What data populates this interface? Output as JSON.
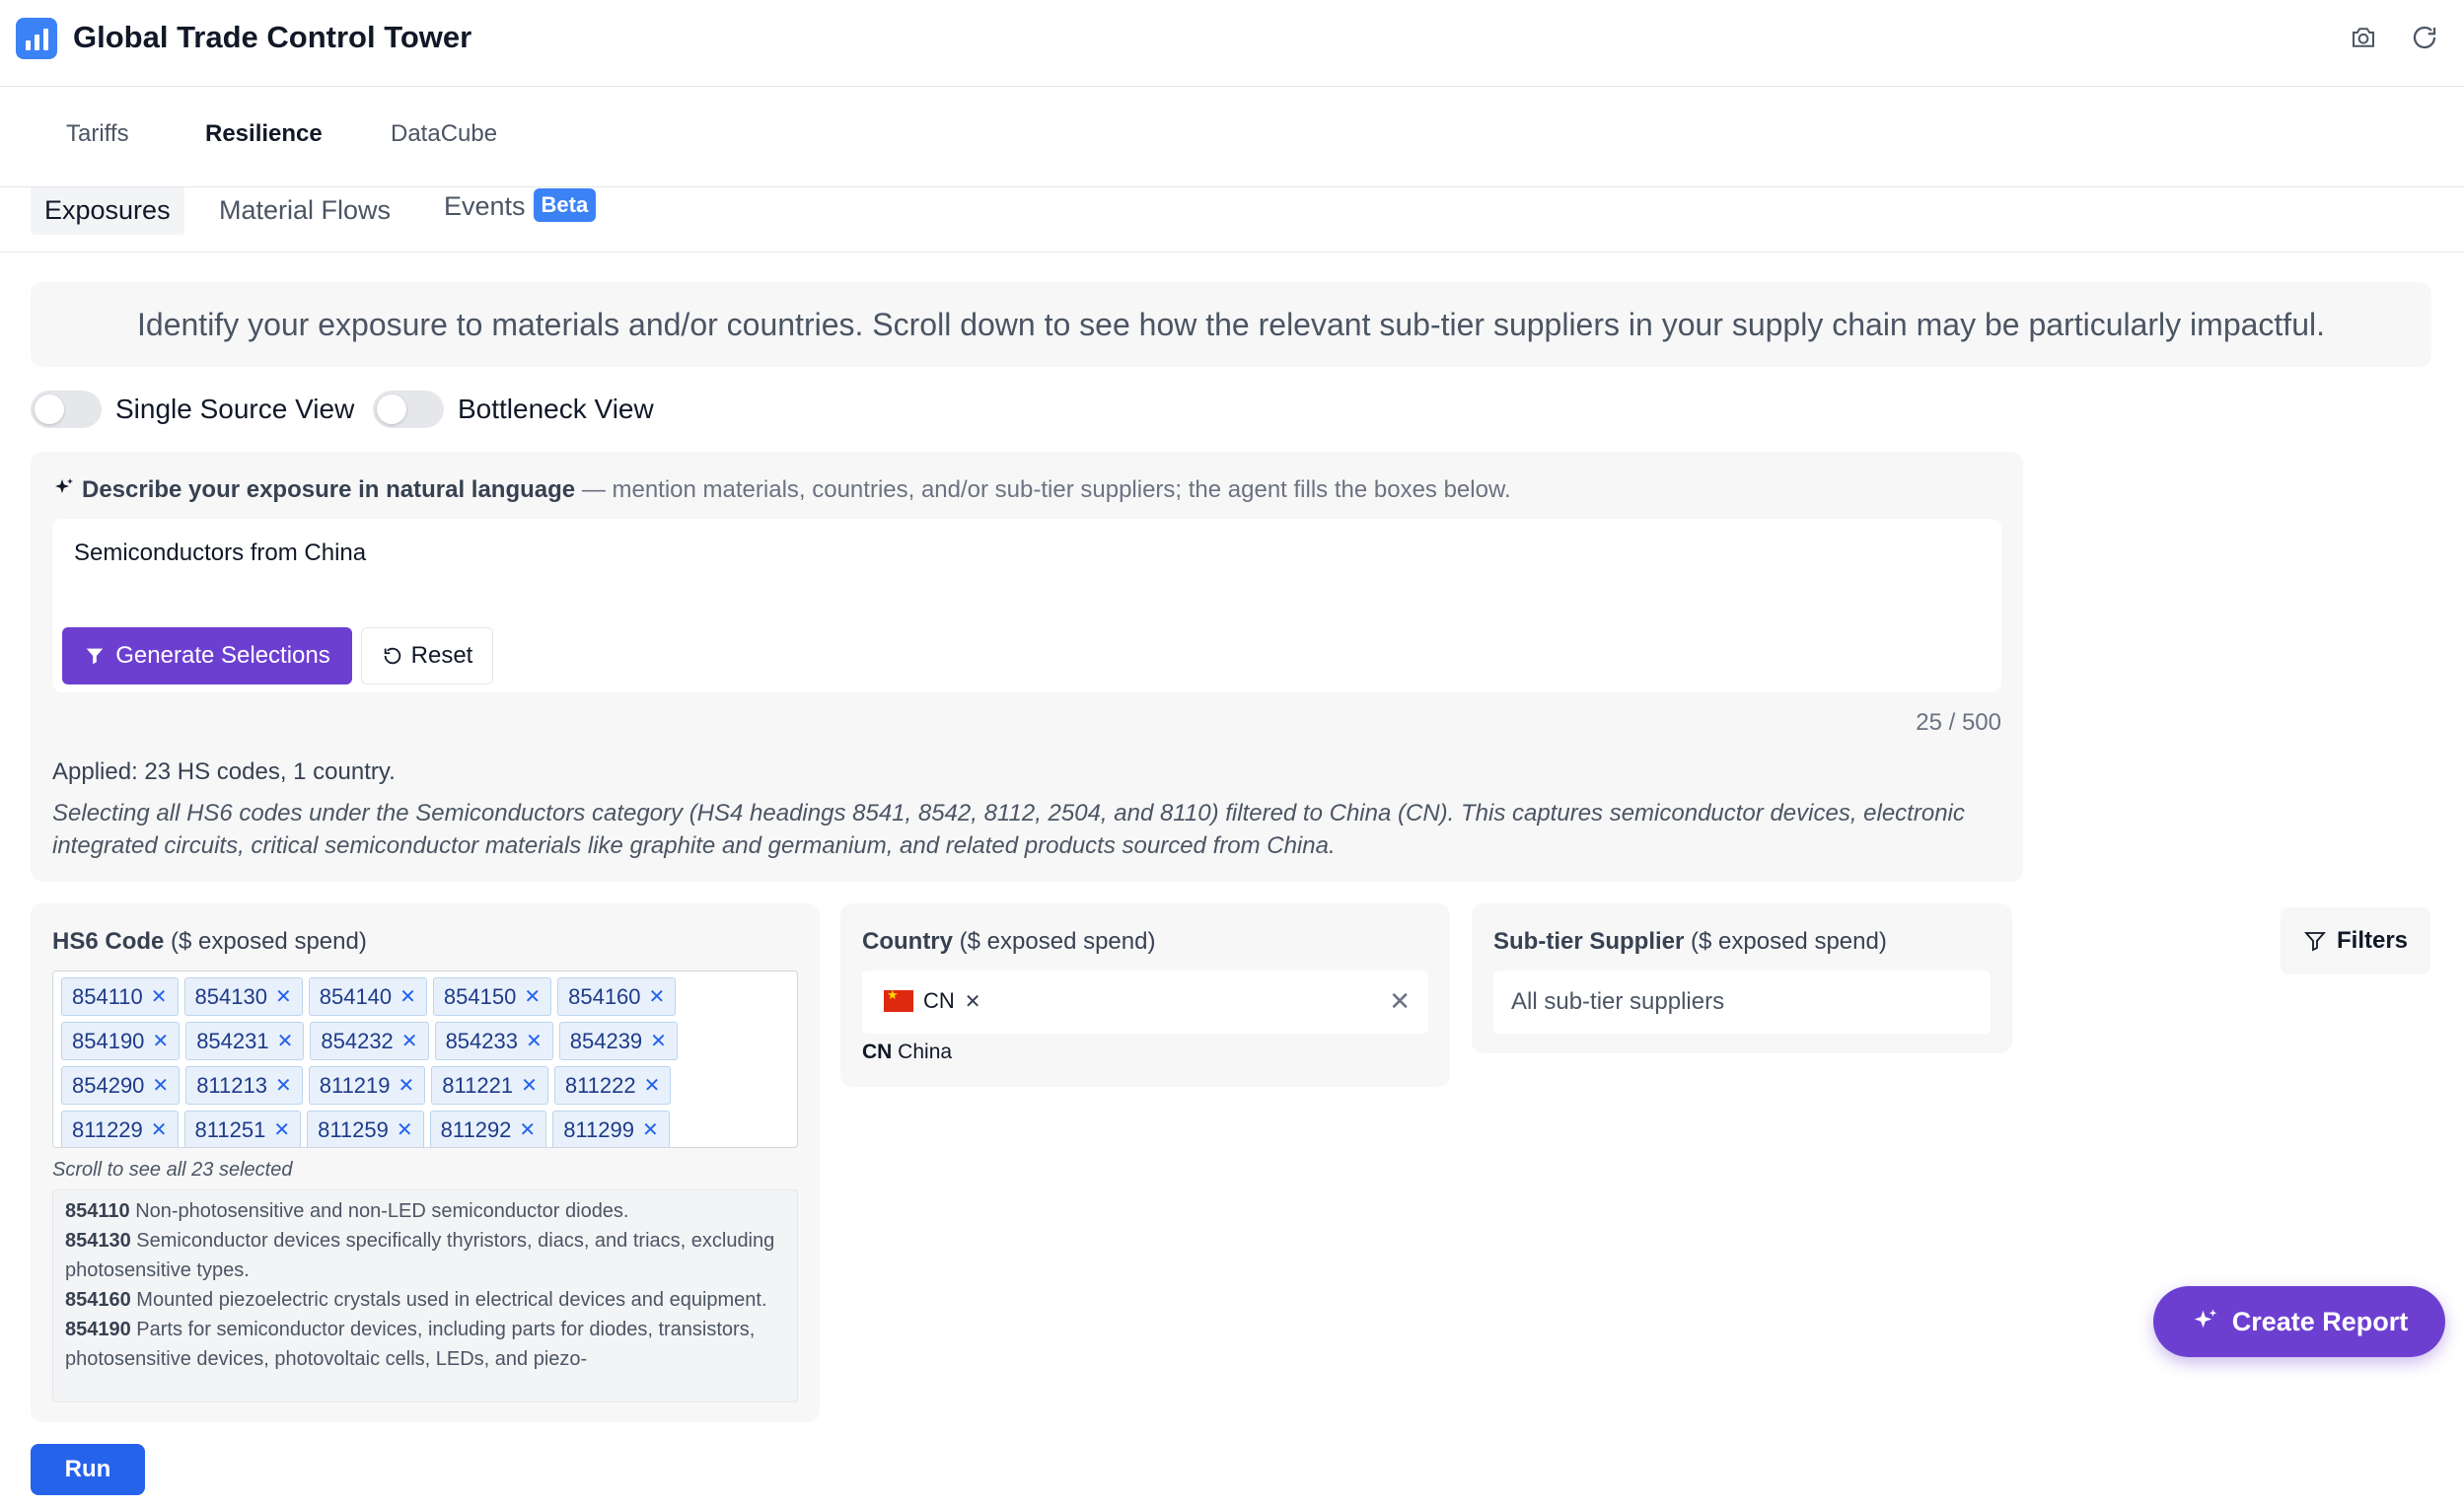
{
  "app": {
    "title": "Global Trade Control Tower"
  },
  "main_tabs": [
    {
      "label": "Tariffs",
      "active": false
    },
    {
      "label": "Resilience",
      "active": true
    },
    {
      "label": "DataCube",
      "active": false
    }
  ],
  "sub_tabs": [
    {
      "label": "Exposures",
      "active": true
    },
    {
      "label": "Material Flows",
      "active": false
    },
    {
      "label": "Events",
      "active": false,
      "badge": "Beta"
    }
  ],
  "intro_text": "Identify your exposure to materials and/or countries. Scroll down to see how the relevant sub-tier suppliers in your supply chain may be particularly impactful.",
  "toggles": [
    {
      "label": "Single Source View",
      "on": false
    },
    {
      "label": "Bottleneck View",
      "on": false
    }
  ],
  "nl": {
    "title": "Describe your exposure in natural language",
    "hint": " — mention materials, countries, and/or sub-tier suppliers; the agent fills the boxes below.",
    "input_value": "Semiconductors from China",
    "generate_label": "Generate Selections",
    "reset_label": "Reset",
    "char_count": "25 / 500",
    "applied": "Applied: 23 HS codes, 1 country.",
    "applied_desc": "Selecting all HS6 codes under the Semiconductors category (HS4 headings 8541, 8542, 8112, 2504, and 8110) filtered to China (CN). This captures semiconductor devices, electronic integrated circuits, critical semiconductor materials like graphite and germanium, and related products sourced from China."
  },
  "hs6": {
    "title": "HS6 Code",
    "title_suffix": " ($ exposed spend)",
    "rows": [
      [
        "854110",
        "854130",
        "854140",
        "854150",
        "854160"
      ],
      [
        "854190",
        "854231",
        "854232",
        "854233",
        "854239"
      ],
      [
        "854290",
        "811213",
        "811219",
        "811221",
        "811222"
      ],
      [
        "811229",
        "811251",
        "811259",
        "811292",
        "811299"
      ]
    ],
    "scroll_note": "Scroll to see all 23 selected",
    "descriptions": [
      {
        "code": "854110",
        "text": " Non-photosensitive and non-LED semiconductor diodes."
      },
      {
        "code": "854130",
        "text": " Semiconductor devices specifically thyristors, diacs, and triacs, excluding photosensitive types."
      },
      {
        "code": "854160",
        "text": " Mounted piezoelectric crystals used in electrical devices and equipment."
      },
      {
        "code": "854190",
        "text": " Parts for semiconductor devices, including parts for diodes, transistors, photosensitive devices, photovoltaic cells, LEDs, and piezo-"
      }
    ]
  },
  "country": {
    "title": "Country",
    "title_suffix": " ($ exposed spend)",
    "chip": "CN",
    "code": "CN",
    "name": " China"
  },
  "supplier": {
    "title": "Sub-tier Supplier",
    "title_suffix": " ($ exposed spend)",
    "placeholder": "All sub-tier suppliers"
  },
  "filters_label": "Filters",
  "create_report_label": "Create Report",
  "run_label": "Run",
  "colors": {
    "accent_purple": "#6d3fd1",
    "accent_blue": "#2563eb",
    "logo_blue": "#3b82f6"
  }
}
